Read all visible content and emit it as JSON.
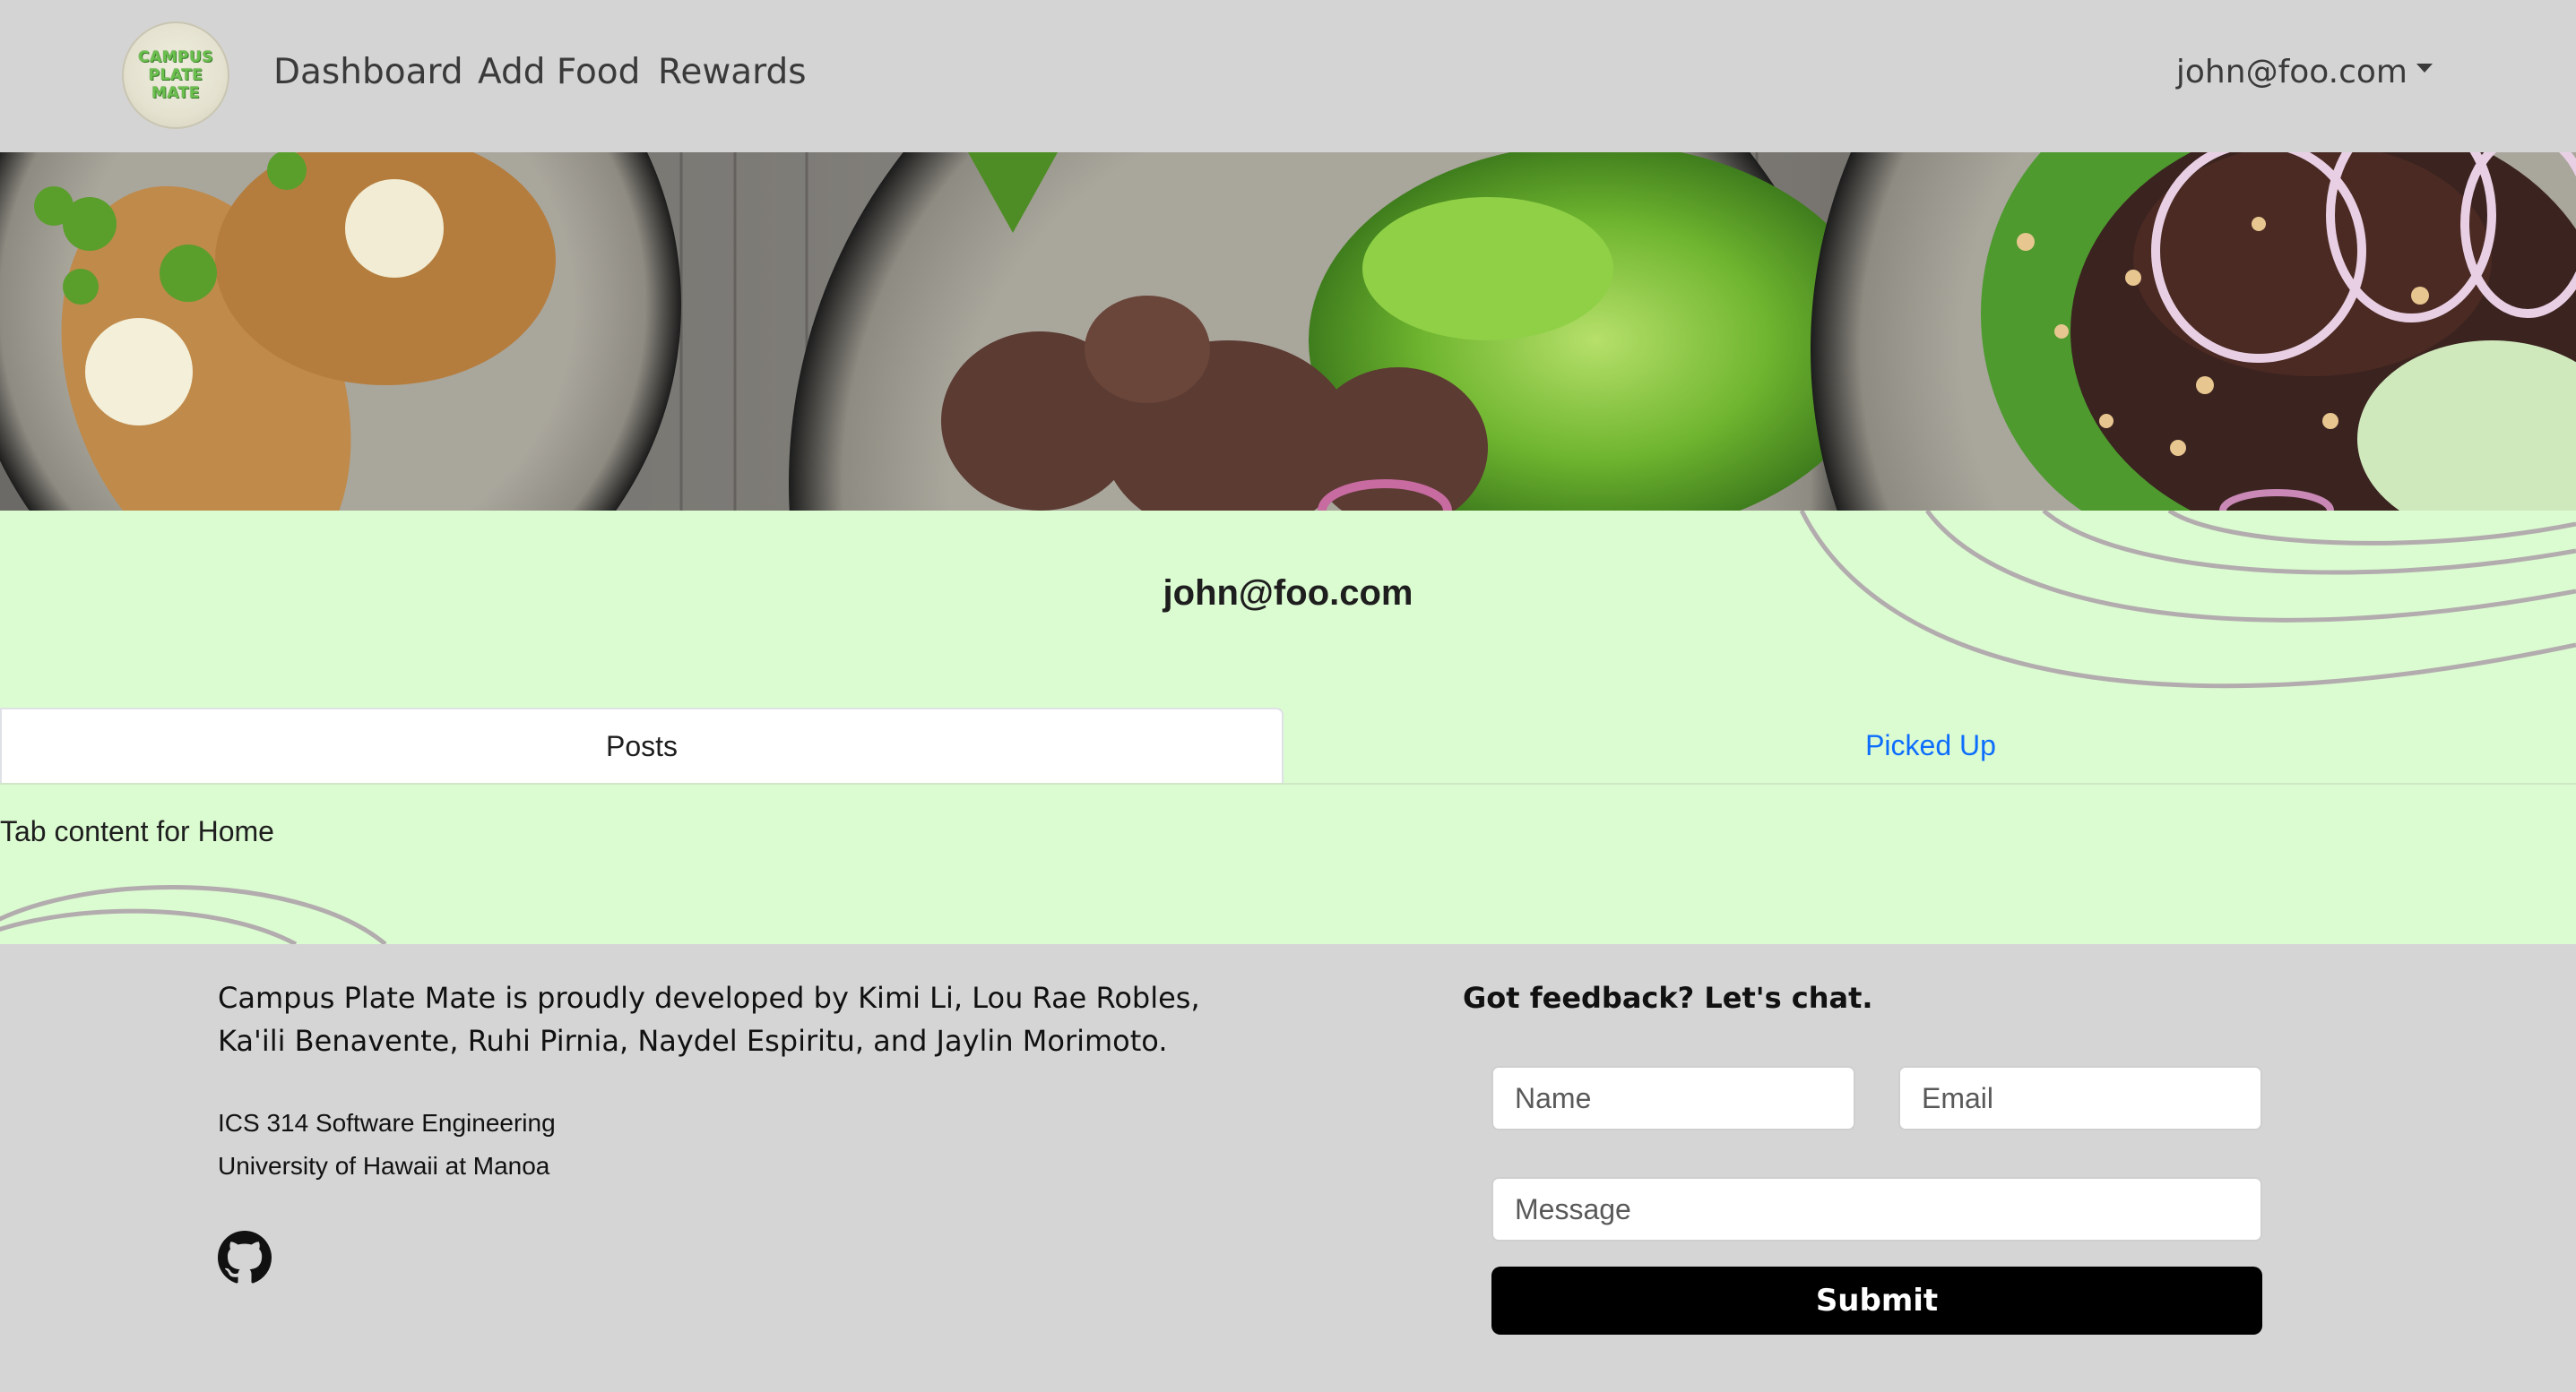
{
  "navbar": {
    "logo_text": "CAMPUS\nPLATE\nMATE",
    "links": [
      {
        "label": "Dashboard"
      },
      {
        "label": "Add Food"
      },
      {
        "label": "Rewards"
      }
    ],
    "user_label": "john@foo.com"
  },
  "profile": {
    "title": "john@foo.com",
    "tabs": [
      {
        "label": "Posts",
        "active": true
      },
      {
        "label": "Picked Up",
        "active": false
      }
    ],
    "tab_content": "Tab content for Home"
  },
  "footer": {
    "credits": "Campus Plate Mate is proudly developed by Kimi Li, Lou Rae Robles, Ka'ili Benavente, Ruhi Pirnia, Naydel Espiritu, and Jaylin Morimoto.",
    "course_line1": "ICS 314 Software Engineering",
    "course_line2": "University of Hawaii at Manoa",
    "feedback_title": "Got feedback? Let's chat.",
    "form": {
      "name_placeholder": "Name",
      "email_placeholder": "Email",
      "message_placeholder": "Message",
      "submit_label": "Submit"
    }
  },
  "colors": {
    "navbar_bg": "#d4d4d4",
    "profile_bg": "#dbfbd1",
    "footer_bg": "#d5d5d5",
    "tab_link": "#0d6efd",
    "submit_bg": "#000000"
  },
  "icons": [
    "github-icon",
    "caret-down-icon"
  ]
}
